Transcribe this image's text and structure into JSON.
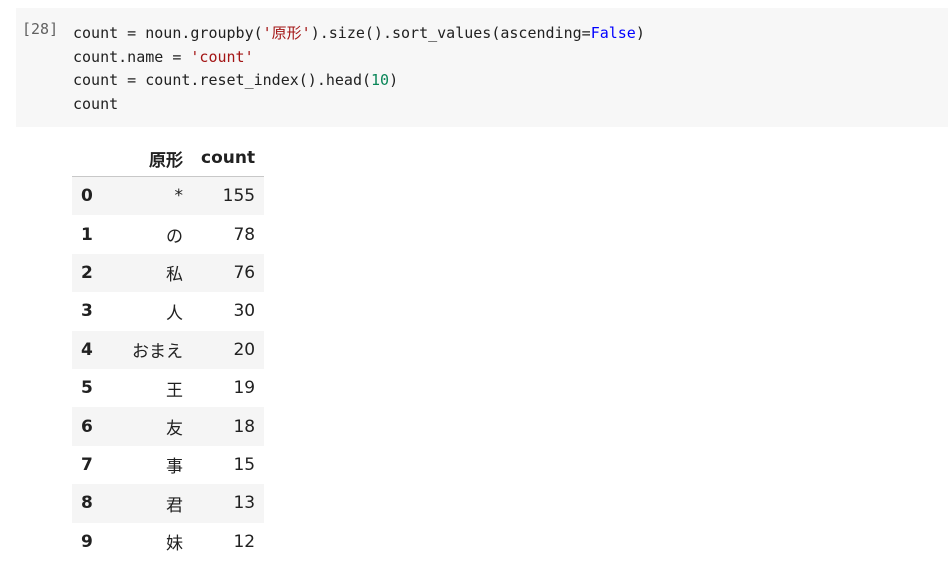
{
  "cell": {
    "prompt": "[28]",
    "code": {
      "line1": {
        "a": "count = noun.groupby(",
        "b": "'原形'",
        "c": ").size().sort_values(ascending=",
        "d": "False",
        "e": ")"
      },
      "line2": {
        "a": "count.name = ",
        "b": "'count'"
      },
      "line3": {
        "a": "count = count.reset_index().head(",
        "b": "10",
        "c": ")"
      },
      "line4": {
        "a": "count"
      }
    }
  },
  "output": {
    "columns": [
      "",
      "原形",
      "count"
    ],
    "rows": [
      {
        "index": "0",
        "word": "*",
        "count": "155"
      },
      {
        "index": "1",
        "word": "の",
        "count": "78"
      },
      {
        "index": "2",
        "word": "私",
        "count": "76"
      },
      {
        "index": "3",
        "word": "人",
        "count": "30"
      },
      {
        "index": "4",
        "word": "おまえ",
        "count": "20"
      },
      {
        "index": "5",
        "word": "王",
        "count": "19"
      },
      {
        "index": "6",
        "word": "友",
        "count": "18"
      },
      {
        "index": "7",
        "word": "事",
        "count": "15"
      },
      {
        "index": "8",
        "word": "君",
        "count": "13"
      },
      {
        "index": "9",
        "word": "妹",
        "count": "12"
      }
    ]
  }
}
